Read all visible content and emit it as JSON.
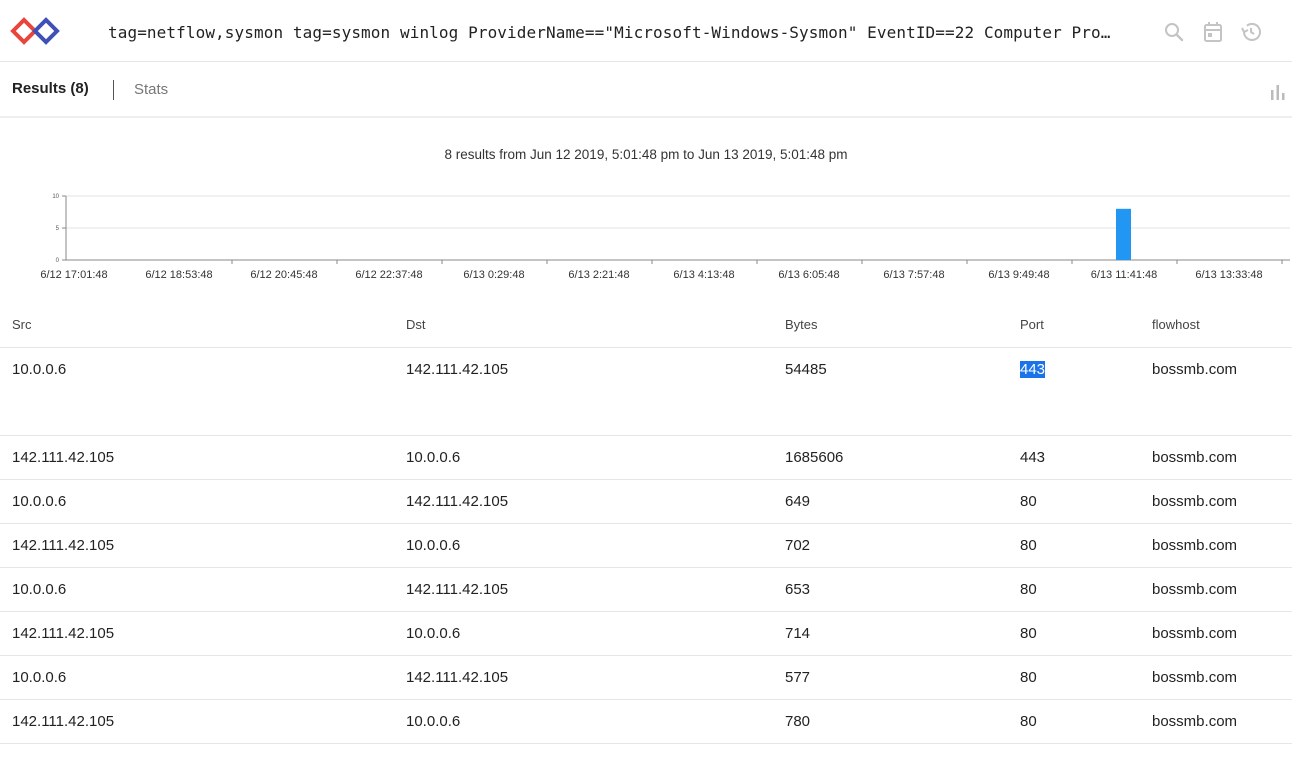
{
  "query": {
    "text": "tag=netflow,sysmon tag=sysmon winlog ProviderName==\"Microsoft-Windows-Sysmon\" EventID==22 Computer Pro…",
    "icons": [
      "search-icon",
      "calendar-icon",
      "history-icon"
    ]
  },
  "tabs": {
    "results_label": "Results (8)",
    "stats_label": "Stats"
  },
  "chart_caption": "8 results from Jun 12 2019, 5:01:48 pm to Jun 13 2019, 5:01:48 pm",
  "chart_data": {
    "type": "bar",
    "categories": [
      "6/12 17:01:48",
      "6/12 18:53:48",
      "6/12 20:45:48",
      "6/12 22:37:48",
      "6/13 0:29:48",
      "6/13 2:21:48",
      "6/13 4:13:48",
      "6/13 6:05:48",
      "6/13 7:57:48",
      "6/13 9:49:48",
      "6/13 11:41:48",
      "6/13 13:33:48"
    ],
    "values": [
      0,
      0,
      0,
      0,
      0,
      0,
      0,
      0,
      0,
      0,
      8,
      0
    ],
    "ylim": [
      0,
      10
    ],
    "yticks": [
      "0",
      "5",
      "10"
    ],
    "bar_color": "#2196f3",
    "grid": true
  },
  "table": {
    "columns": [
      "Src",
      "Dst",
      "Bytes",
      "Port",
      "flowhost"
    ],
    "rows": [
      [
        "10.0.0.6",
        "142.111.42.105",
        "54485",
        "443",
        "bossmb.com"
      ],
      [
        "142.111.42.105",
        "10.0.0.6",
        "1685606",
        "443",
        "bossmb.com"
      ],
      [
        "10.0.0.6",
        "142.111.42.105",
        "649",
        "80",
        "bossmb.com"
      ],
      [
        "142.111.42.105",
        "10.0.0.6",
        "702",
        "80",
        "bossmb.com"
      ],
      [
        "10.0.0.6",
        "142.111.42.105",
        "653",
        "80",
        "bossmb.com"
      ],
      [
        "142.111.42.105",
        "10.0.0.6",
        "714",
        "80",
        "bossmb.com"
      ],
      [
        "10.0.0.6",
        "142.111.42.105",
        "577",
        "80",
        "bossmb.com"
      ],
      [
        "142.111.42.105",
        "10.0.0.6",
        "780",
        "80",
        "bossmb.com"
      ]
    ]
  },
  "colors": {
    "selection": "#1a73e8",
    "logo_red": "#e8453c",
    "logo_blue": "#3f51b5"
  }
}
